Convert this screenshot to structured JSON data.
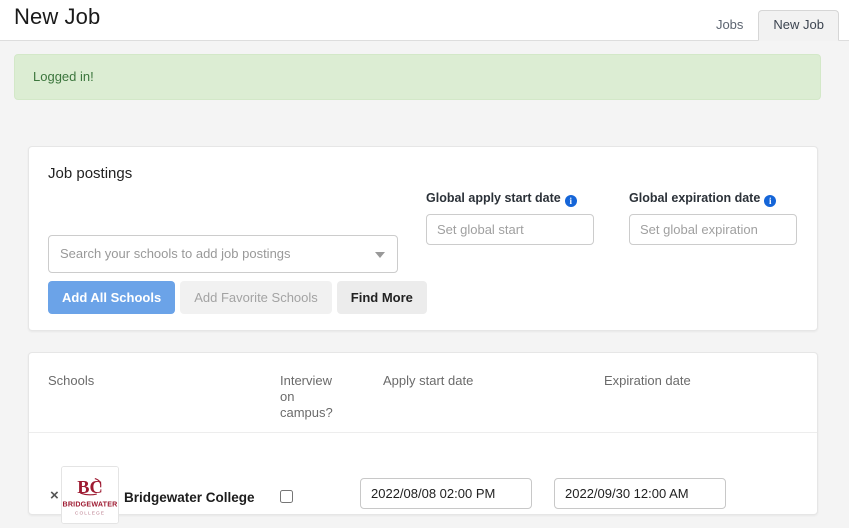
{
  "header": {
    "title": "New Job",
    "tabs": [
      {
        "label": "Jobs",
        "active": false
      },
      {
        "label": "New Job",
        "active": true
      }
    ]
  },
  "alert": {
    "message": "Logged in!",
    "bg_color": "#dcedd3",
    "text_color": "#3c763d"
  },
  "job_postings_card": {
    "title": "Job postings",
    "search_select": {
      "placeholder": "Search your schools to add job postings",
      "value": "",
      "caret_icon": "chevron-down-icon"
    },
    "buttons": {
      "add_all": "Add All Schools",
      "add_favorite": "Add Favorite Schools",
      "find_more": "Find More"
    },
    "global_apply_start": {
      "label": "Global apply start date",
      "info_icon": "info-icon",
      "placeholder": "Set global start",
      "value": ""
    },
    "global_expiration": {
      "label": "Global expiration date",
      "info_icon": "info-icon",
      "placeholder": "Set global expiration",
      "value": ""
    }
  },
  "schools_table": {
    "columns": {
      "schools": "Schools",
      "interview_on_campus": "Interview on campus?",
      "apply_start_date": "Apply start date",
      "expiration_date": "Expiration date"
    },
    "rows": [
      {
        "remove_label": "×",
        "logo_alt": "Bridgewater College",
        "logo_line1": "BRIDGEWATER",
        "logo_line2": "COLLEGE",
        "logo_monogram": "BC",
        "logo_color": "#9e1b32",
        "school_name": "Bridgewater College",
        "interview_on_campus": false,
        "apply_start_date": "2022/08/08 02:00 PM",
        "expiration_date": "2022/09/30 12:00 AM"
      }
    ]
  },
  "colors": {
    "primary_button": "#6ba3e8",
    "page_background": "#f4f4f4",
    "info_blue": "#1565d8"
  }
}
